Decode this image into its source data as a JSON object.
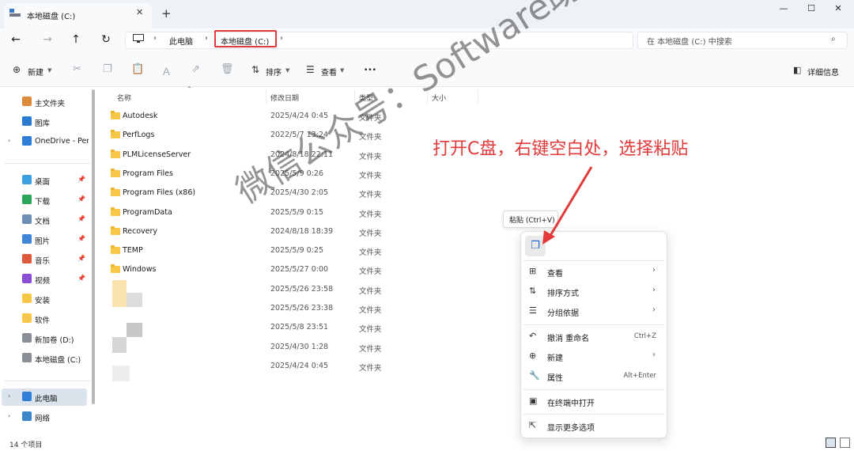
{
  "window": {
    "tab_title": "本地磁盘 (C:)",
    "new_tab": "+",
    "close_tab": "✕",
    "minimize": "—",
    "maximize": "☐",
    "close": "✕"
  },
  "nav": {
    "back": "←",
    "forward": "→",
    "up": "↑",
    "refresh": "↻"
  },
  "breadcrumb": {
    "this_pc": "此电脑",
    "drive": "本地磁盘 (C:)",
    "sep": "›"
  },
  "search": {
    "placeholder": "在 本地磁盘 (C:) 中搜索",
    "icon": "⌕"
  },
  "toolbar": {
    "new_label": "新建",
    "sort_label": "排序",
    "view_label": "查看",
    "more_label": "•••",
    "details_label": "详细信息",
    "icons": [
      "plus-circle-icon",
      "cut-icon",
      "copy-icon",
      "paste-icon",
      "rename-icon",
      "share-icon",
      "delete-icon",
      "sort-icon",
      "view-icon",
      "details-pane-icon"
    ]
  },
  "sidebar": {
    "items": [
      {
        "label": "主文件夹",
        "icon": "home-icon",
        "color": "#e08a3c",
        "pinned": false
      },
      {
        "label": "图库",
        "icon": "gallery-icon",
        "color": "#2b7bd1",
        "pinned": false
      },
      {
        "label": "OneDrive - Per",
        "icon": "onedrive-icon",
        "color": "#2f7fd6",
        "pinned": false
      },
      {
        "label": "桌面",
        "icon": "desktop-icon",
        "color": "#3aa0e0",
        "pinned": true
      },
      {
        "label": "下载",
        "icon": "download-icon",
        "color": "#2aa55a",
        "pinned": true
      },
      {
        "label": "文档",
        "icon": "documents-icon",
        "color": "#6d8fb3",
        "pinned": true
      },
      {
        "label": "图片",
        "icon": "pictures-icon",
        "color": "#3d86d8",
        "pinned": true
      },
      {
        "label": "音乐",
        "icon": "music-icon",
        "color": "#e0583c",
        "pinned": true
      },
      {
        "label": "视频",
        "icon": "videos-icon",
        "color": "#8a4fd6",
        "pinned": true
      },
      {
        "label": "安装",
        "icon": "folder-icon",
        "color": "#f7c847",
        "pinned": false
      },
      {
        "label": "软件",
        "icon": "folder-icon",
        "color": "#f7c847",
        "pinned": false
      },
      {
        "label": "新加卷 (D:)",
        "icon": "drive-icon",
        "color": "#8a8f96",
        "pinned": false
      },
      {
        "label": "本地磁盘 (C:)",
        "icon": "drive-icon",
        "color": "#8a8f96",
        "pinned": false
      },
      {
        "label": "此电脑",
        "icon": "this-pc-icon",
        "color": "#2f7fd6",
        "pinned": false
      },
      {
        "label": "网络",
        "icon": "network-icon",
        "color": "#3a86c8",
        "pinned": false
      }
    ]
  },
  "columns": {
    "name": "名称",
    "date": "修改日期",
    "type": "类型",
    "size": "大小"
  },
  "files": [
    {
      "name": "Autodesk",
      "date": "2025/4/24 0:45",
      "type": "文件夹"
    },
    {
      "name": "PerfLogs",
      "date": "2022/5/7 13:24",
      "type": "文件夹"
    },
    {
      "name": "PLMLicenseServer",
      "date": "2024/8/18 22:11",
      "type": "文件夹"
    },
    {
      "name": "Program Files",
      "date": "2025/5/9 0:26",
      "type": "文件夹"
    },
    {
      "name": "Program Files (x86)",
      "date": "2025/4/30 2:05",
      "type": "文件夹"
    },
    {
      "name": "ProgramData",
      "date": "2025/5/9 0:15",
      "type": "文件夹"
    },
    {
      "name": "Recovery",
      "date": "2024/8/18 18:39",
      "type": "文件夹"
    },
    {
      "name": "TEMP",
      "date": "2025/5/9 0:25",
      "type": "文件夹"
    },
    {
      "name": "Windows",
      "date": "2025/5/27 0:00",
      "type": "文件夹"
    },
    {
      "name": "",
      "date": "2025/5/26 23:58",
      "type": "文件夹"
    },
    {
      "name": "",
      "date": "2025/5/26 23:38",
      "type": "文件夹"
    },
    {
      "name": "",
      "date": "2025/5/8 23:51",
      "type": "文件夹"
    },
    {
      "name": "",
      "date": "2025/4/30 1:28",
      "type": "文件夹"
    },
    {
      "name": "",
      "date": "2025/4/24 0:45",
      "type": "文件夹"
    }
  ],
  "status": {
    "count": "14 个项目"
  },
  "annotation": {
    "text": "打开C盘，右键空白处，选择粘贴",
    "color": "#e23a3a"
  },
  "tooltip": {
    "text": "粘贴 (Ctrl+V)"
  },
  "context_menu": {
    "items": [
      {
        "label": "查看",
        "icon": "grid-icon",
        "glyph": "⊞",
        "accel": "",
        "submenu": true
      },
      {
        "label": "排序方式",
        "icon": "sort-icon",
        "glyph": "⇅",
        "accel": "",
        "submenu": true
      },
      {
        "label": "分组依据",
        "icon": "group-icon",
        "glyph": "☰",
        "accel": "",
        "submenu": true
      },
      {
        "label": "撤消 重命名",
        "icon": "undo-icon",
        "glyph": "↶",
        "accel": "Ctrl+Z",
        "submenu": false
      },
      {
        "label": "新建",
        "icon": "plus-circle-icon",
        "glyph": "⊕",
        "accel": "",
        "submenu": true
      },
      {
        "label": "属性",
        "icon": "wrench-icon",
        "glyph": "🔧",
        "accel": "Alt+Enter",
        "submenu": false
      },
      {
        "label": "在终端中打开",
        "icon": "terminal-icon",
        "glyph": "▣",
        "accel": "",
        "submenu": false
      },
      {
        "label": "显示更多选项",
        "icon": "more-options-icon",
        "glyph": "⇱",
        "accel": "",
        "submenu": false
      }
    ],
    "chevron": "›"
  },
  "watermark": {
    "text": "微信公众号：Software助手"
  }
}
